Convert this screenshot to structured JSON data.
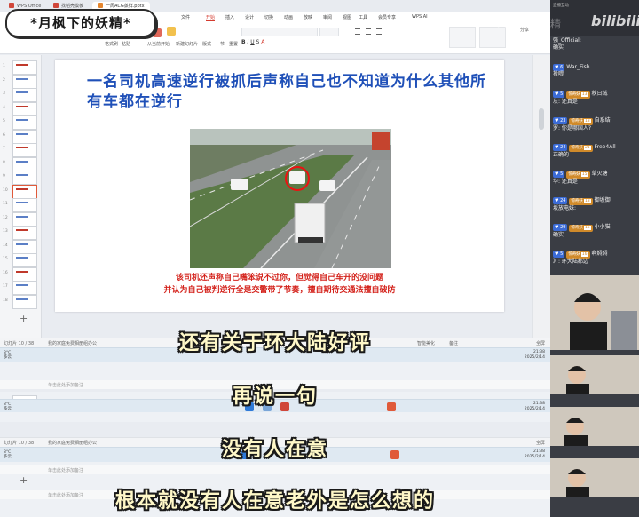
{
  "tabs": [
    {
      "label": "WPS Office",
      "color": "#d0473a"
    },
    {
      "label": "找稻壳模板",
      "color": "#d0473a"
    },
    {
      "label": "一周ACG蒸鲜.pptx",
      "color": "#e5862f"
    }
  ],
  "menu": [
    "文件",
    "开始",
    "插入",
    "设计",
    "切换",
    "动画",
    "放映",
    "审阅",
    "视图",
    "工具",
    "会员专享",
    "WPS AI"
  ],
  "menu_active_index": 1,
  "ribbon": {
    "paste": "粘贴",
    "format_painter": "格式刷",
    "new_slide": "新建幻灯片",
    "layout": "版式",
    "section": "节",
    "reset": "重置",
    "from_current": "从当前开始",
    "share": "分享"
  },
  "thumbs": [
    "1",
    "2",
    "3",
    "4",
    "5",
    "6",
    "7",
    "8",
    "9",
    "10",
    "11",
    "12",
    "13",
    "14",
    "15",
    "16",
    "17",
    "18"
  ],
  "slide": {
    "title": "一名司机高速逆行被抓后声称自己也不知道为什么其他所有车都在逆行",
    "caption1": "该司机还声称自己嘴笨说不过你，但觉得自己车开的没问题",
    "caption2": "并认为自己被判逆行全是交警带了节奏，擅自期待交通法擅自破防"
  },
  "status": {
    "page": "幻灯片 10 / 38",
    "theme": "我的家庭免费相册组办公",
    "notes_placeholder": "单击此处添加备注",
    "smart": "智能美化",
    "notes": "备注",
    "zoom": "全屏"
  },
  "taskbar": {
    "temp": "8°C",
    "weather": "多云",
    "time": "21:38",
    "date": "2025/2/14"
  },
  "subtitles": [
    "还有关于环大陆好评",
    "再说一句",
    "没有人在意",
    "根本就没有人在意老外是怎么想的"
  ],
  "badge": "*月枫下的妖精*",
  "chat": {
    "header": "直播互动",
    "watermark": "月枫下的妖精",
    "brand": "bilibili",
    "messages": [
      {
        "prefix": "",
        "name": "强_Official:",
        "text": "确实"
      },
      {
        "lvl": "6",
        "name": "War_Fish",
        "text": "投喂"
      },
      {
        "lvl": "5",
        "medal": "惊奇妖",
        "mnum": "13",
        "name": "秋日绒",
        "text": "灰: 还真是"
      },
      {
        "lvl": "23",
        "medal": "惊奇妖",
        "mnum": "18",
        "name": "自系结",
        "text": "罗: 你是哪国人?"
      },
      {
        "lvl": "24",
        "medal": "惊奇妖",
        "mnum": "21",
        "name": "Free4All-",
        "text": "正确的"
      },
      {
        "lvl": "5",
        "medal": "惊奇妖",
        "mnum": "15",
        "name": "草火塘",
        "text": "华: 还真是"
      },
      {
        "lvl": "24",
        "medal": "惊奇妖",
        "mnum": "18",
        "name": "御坂御",
        "text": "坂放电妹:"
      },
      {
        "lvl": "29",
        "medal": "惊奇妖",
        "mnum": "16",
        "name": "小小猫:",
        "text": "确实"
      },
      {
        "lvl": "5",
        "medal": "惊奇妖",
        "mnum": "16",
        "name": "啊焖焖",
        "text": "》: 环大陆都边"
      }
    ]
  },
  "colors": {
    "accent_red": "#d43b2f",
    "title_blue": "#1f50b8",
    "caption_red": "#d4231c",
    "subtitle_fill": "#fff8c8"
  }
}
